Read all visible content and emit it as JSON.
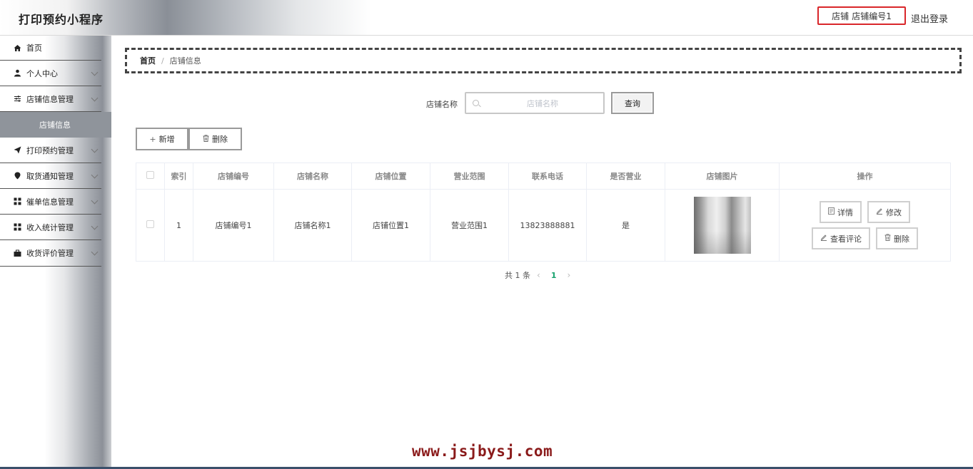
{
  "app": {
    "title": "打印预约小程序"
  },
  "header": {
    "user_role": "店铺",
    "user_name": "店铺编号1",
    "logout_label": "退出登录"
  },
  "sidebar": {
    "items": [
      {
        "label": "首页",
        "icon": "home-icon"
      },
      {
        "label": "个人中心",
        "icon": "user-icon"
      },
      {
        "label": "店铺信息管理",
        "icon": "sliders-icon"
      },
      {
        "label": "打印预约管理",
        "icon": "send-icon"
      },
      {
        "label": "取货通知管理",
        "icon": "location-icon"
      },
      {
        "label": "催单信息管理",
        "icon": "grid-icon"
      },
      {
        "label": "收入统计管理",
        "icon": "grid-icon"
      },
      {
        "label": "收货评价管理",
        "icon": "briefcase-icon"
      }
    ],
    "active_sub_item": "店铺信息"
  },
  "breadcrumb": {
    "home": "首页",
    "separator": "/",
    "current": "店铺信息"
  },
  "search": {
    "label": "店铺名称",
    "placeholder": "店铺名称",
    "value": "",
    "button": "查询"
  },
  "toolbar": {
    "add_label": "新增",
    "delete_label": "删除"
  },
  "table": {
    "columns": [
      "索引",
      "店铺编号",
      "店铺名称",
      "店铺位置",
      "营业范围",
      "联系电话",
      "是否营业",
      "店铺图片",
      "操作"
    ],
    "rows": [
      {
        "index": "1",
        "shop_no": "店铺编号1",
        "shop_name": "店铺名称1",
        "location": "店铺位置1",
        "scope": "营业范围1",
        "phone": "13823888881",
        "open": "是"
      }
    ],
    "row_actions": {
      "detail": "详情",
      "edit": "修改",
      "comments": "查看评论",
      "delete": "删除"
    }
  },
  "pagination": {
    "total_text": "共 1 条",
    "current_page": "1"
  },
  "watermark": "www.jsjbysj.com",
  "colors": {
    "highlight_border": "#d9262a",
    "active_menu_bg": "#8f949b",
    "page_active": "#1aa36f",
    "watermark": "#8a1a1a"
  }
}
